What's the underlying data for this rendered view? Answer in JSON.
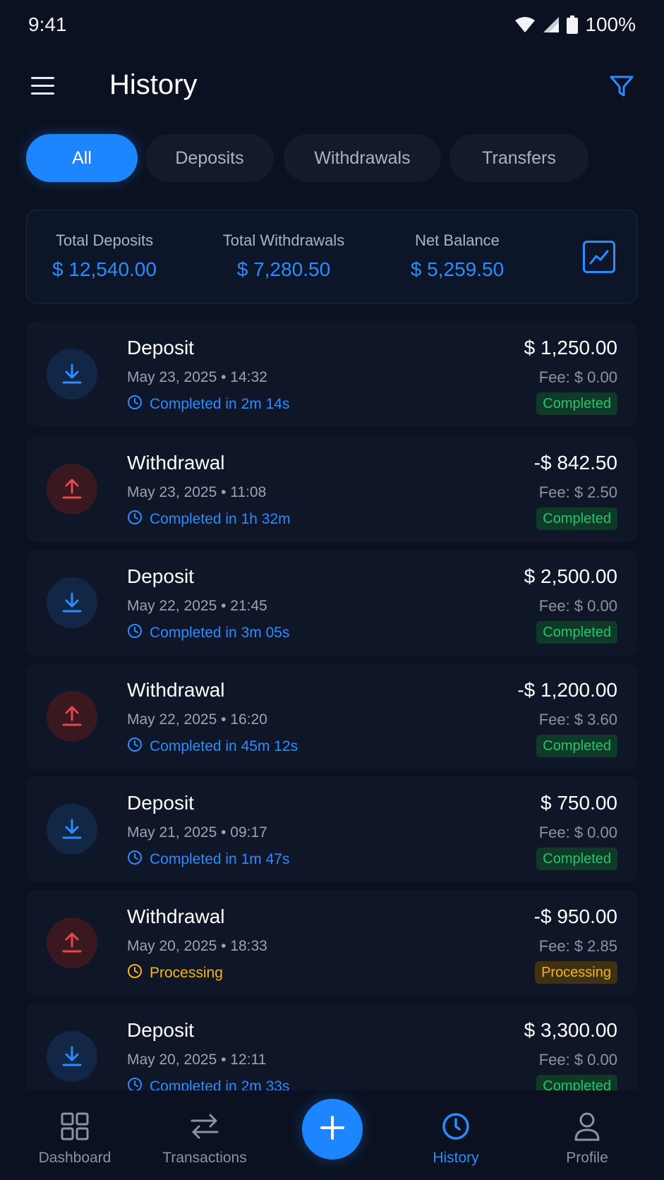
{
  "status_bar": {
    "time": "9:41",
    "battery": "100%"
  },
  "header": {
    "title": "History"
  },
  "tabs": [
    {
      "label": "All",
      "active": true
    },
    {
      "label": "Deposits",
      "active": false
    },
    {
      "label": "Withdrawals",
      "active": false
    },
    {
      "label": "Transfers",
      "active": false
    }
  ],
  "summary": {
    "total_deposits_label": "Total Deposits",
    "total_deposits_value": "$ 12,540.00",
    "total_withdrawals_label": "Total Withdrawals",
    "total_withdrawals_value": "$ 7,280.50",
    "net_balance_label": "Net Balance",
    "net_balance_value": "$ 5,259.50"
  },
  "transactions": [
    {
      "type": "Deposit",
      "date": "May 23, 2025 • 14:32",
      "status_line": "Completed in 2m 14s",
      "amount": "$ 1,250.00",
      "fee": "Fee: $ 0.00",
      "badge": "Completed"
    },
    {
      "type": "Withdrawal",
      "date": "May 23, 2025 • 11:08",
      "status_line": "Completed in 1h 32m",
      "amount": "-$ 842.50",
      "fee": "Fee: $ 2.50",
      "badge": "Completed"
    },
    {
      "type": "Deposit",
      "date": "May 22, 2025 • 21:45",
      "status_line": "Completed in 3m 05s",
      "amount": "$ 2,500.00",
      "fee": "Fee: $ 0.00",
      "badge": "Completed"
    },
    {
      "type": "Withdrawal",
      "date": "May 22, 2025 • 16:20",
      "status_line": "Completed in 45m 12s",
      "amount": "-$ 1,200.00",
      "fee": "Fee: $ 3.60",
      "badge": "Completed"
    },
    {
      "type": "Deposit",
      "date": "May 21, 2025 • 09:17",
      "status_line": "Completed in 1m 47s",
      "amount": "$ 750.00",
      "fee": "Fee: $ 0.00",
      "badge": "Completed"
    },
    {
      "type": "Withdrawal",
      "date": "May 20, 2025 • 18:33",
      "status_line": "Processing",
      "amount": "-$ 950.00",
      "fee": "Fee: $ 2.85",
      "badge": "Processing"
    },
    {
      "type": "Deposit",
      "date": "May 20, 2025 • 12:11",
      "status_line": "Completed in 2m 33s",
      "amount": "$ 3,300.00",
      "fee": "Fee: $ 0.00",
      "badge": "Completed"
    }
  ],
  "bottom_nav": {
    "dashboard": "Dashboard",
    "transactions": "Transactions",
    "history": "History",
    "profile": "Profile"
  },
  "colors": {
    "accent": "#1d86ff",
    "background": "#0b1120",
    "completed": "#27c46b",
    "processing": "#f5b31d",
    "withdrawal": "#e5484d"
  },
  "icons": {
    "deposit": "download-arrow-icon",
    "withdrawal": "upload-arrow-icon",
    "status": "clock-icon"
  }
}
